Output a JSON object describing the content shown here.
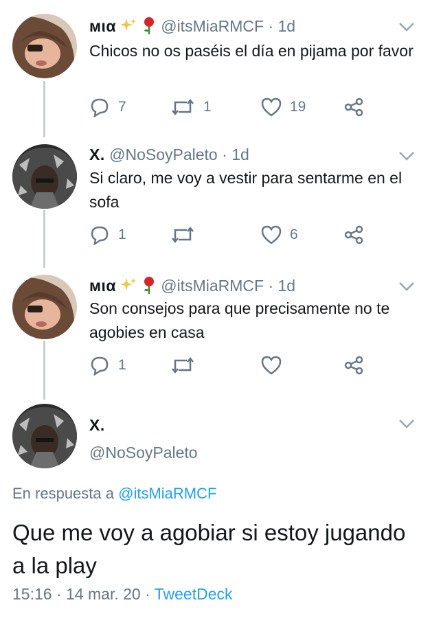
{
  "tweets": [
    {
      "name": "мια",
      "handle": "@itsMiaRMCF",
      "separator": "·",
      "time": "1d",
      "text": "Chicos no os paséis el día en pijama por favor",
      "replies": "7",
      "retweets": "1",
      "likes": "19",
      "name_emojis": [
        "sparkles-icon",
        "rose-icon"
      ]
    },
    {
      "name": "X.",
      "handle": "@NoSoyPaleto",
      "separator": "·",
      "time": "1d",
      "text": "Si claro, me voy a vestir para sentarme en el sofa",
      "replies": "1",
      "retweets": "",
      "likes": "6"
    },
    {
      "name": "мια",
      "handle": "@itsMiaRMCF",
      "separator": "·",
      "time": "1d",
      "text": "Son consejos para que precisamente no te agobies en casa",
      "replies": "1",
      "retweets": "",
      "likes": "",
      "name_emojis": [
        "sparkles-icon",
        "rose-icon"
      ]
    }
  ],
  "focused": {
    "name": "X.",
    "handle": "@NoSoyPaleto",
    "reply_prefix": "En respuesta a",
    "reply_handle": "@itsMiaRMCF",
    "text": "Que me voy a agobiar si estoy jugando a la play",
    "time": "15:16",
    "separator1": "·",
    "date": "14 mar. 20",
    "separator2": "·",
    "source": "TweetDeck"
  },
  "colors": {
    "link": "#1da1f2",
    "secondary": "#657786",
    "thread_line": "#c4cfd6",
    "primary_text": "#14171a"
  }
}
